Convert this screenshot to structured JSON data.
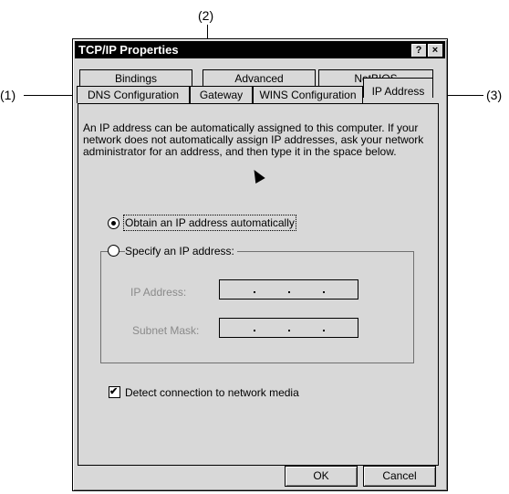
{
  "callouts": {
    "top": "(2)",
    "left": "(1)",
    "right": "(3)"
  },
  "window": {
    "title": "TCP/IP Properties",
    "help_label": "?",
    "close_label": "×"
  },
  "tabs_back": [
    "Bindings",
    "Advanced",
    "NetBIOS"
  ],
  "tabs_front": [
    "DNS Configuration",
    "Gateway",
    "WINS Configuration",
    "IP Address"
  ],
  "description": "An IP address can be automatically assigned to this computer. If your network does not automatically assign IP addresses, ask your network administrator for an address, and then type it in the space below.",
  "options": {
    "obtain_label": "Obtain an IP address automatically",
    "specify_label": "Specify an IP address:",
    "selected": "obtain"
  },
  "fields": {
    "ip_label": "IP Address:",
    "subnet_label": "Subnet Mask:"
  },
  "detect": {
    "label": "Detect connection to network media",
    "checked": true
  },
  "buttons": {
    "ok": "OK",
    "cancel": "Cancel"
  }
}
